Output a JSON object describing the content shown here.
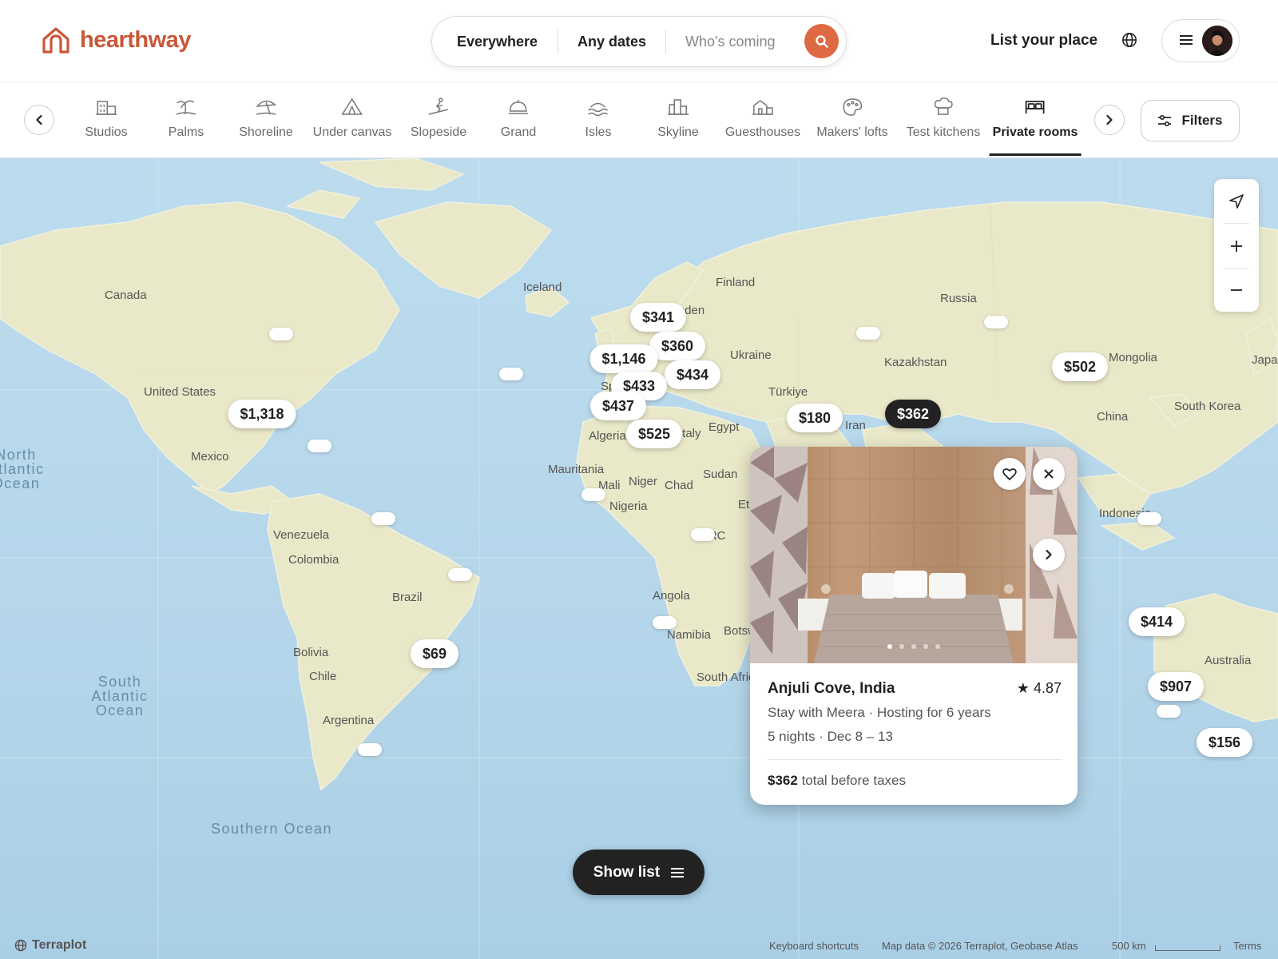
{
  "brand": {
    "name": "hearthway",
    "accent": "#c9583a"
  },
  "search": {
    "where": "Everywhere",
    "when": "Any dates",
    "who": "Who's coming"
  },
  "header": {
    "host_link": "List your place"
  },
  "categories": [
    {
      "label": "Studios",
      "icon": "building-icon"
    },
    {
      "label": "Palms",
      "icon": "palm-tree-icon"
    },
    {
      "label": "Shoreline",
      "icon": "beach-umbrella-icon"
    },
    {
      "label": "Under canvas",
      "icon": "tent-icon"
    },
    {
      "label": "Slopeside",
      "icon": "skier-icon"
    },
    {
      "label": "Grand",
      "icon": "service-bell-icon"
    },
    {
      "label": "Isles",
      "icon": "island-waves-icon"
    },
    {
      "label": "Skyline",
      "icon": "city-skyline-icon"
    },
    {
      "label": "Guesthouses",
      "icon": "guesthouse-icon"
    },
    {
      "label": "Makers' lofts",
      "icon": "palette-icon"
    },
    {
      "label": "Test kitchens",
      "icon": "chef-hat-icon"
    },
    {
      "label": "Private rooms",
      "icon": "bed-icon",
      "active": true
    }
  ],
  "filters_label": "Filters",
  "map": {
    "labels": [
      "Canada",
      "United States",
      "Mexico",
      "Iceland",
      "Finland",
      "Sweden",
      "Russia",
      "Ukraine",
      "Kazakhstan",
      "Türkiye",
      "Iran",
      "Egypt",
      "Algeria",
      "Mauritania",
      "Mali",
      "Niger",
      "Chad",
      "Sudan",
      "Nigeria",
      "Ethiopia",
      "DRC",
      "Angola",
      "Namibia",
      "Botswana",
      "South Africa",
      "Venezuela",
      "Colombia",
      "Brazil",
      "Bolivia",
      "Chile",
      "Argentina",
      "Mongolia",
      "China",
      "South Korea",
      "Japan",
      "Indonesia",
      "Australia",
      "Spain",
      "Italy"
    ],
    "oceans": [
      "North Atlantic Ocean",
      "South Atlantic Ocean",
      "Southern Ocean"
    ],
    "prices": [
      "$341",
      "$360",
      "$1,146",
      "$434",
      "$433",
      "$437",
      "$525",
      "$1,318",
      "$180",
      "$362",
      "$502",
      "$69",
      "$414",
      "$907",
      "$156"
    ],
    "selected_price": "$362"
  },
  "card": {
    "title": "Anjuli Cove, India",
    "rating": "4.87",
    "host_line": "Stay with Meera · Hosting for 6 years",
    "dates_line": "5 nights · Dec 8 – 13",
    "price": "$362",
    "price_suffix": "total before taxes"
  },
  "show_list_label": "Show list",
  "footer": {
    "brand": "Terraplot",
    "shortcuts": "Keyboard shortcuts",
    "attribution": "Map data © 2026 Terraplot, Geobase Atlas",
    "scale": "500 km",
    "terms": "Terms"
  }
}
